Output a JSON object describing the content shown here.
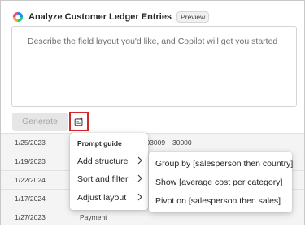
{
  "header": {
    "title": "Analyze Customer Ledger Entries",
    "badge": "Preview"
  },
  "prompt": {
    "placeholder": "Describe the field layout you'd like, and Copilot will get you started"
  },
  "actions": {
    "generate_label": "Generate"
  },
  "grid": {
    "rows": [
      {
        "date": "1/25/2023",
        "doc": "5-INV103009",
        "amount": "30000"
      },
      {
        "date": "1/19/2023",
        "doc": "",
        "amount": ""
      },
      {
        "date": "1/22/2024",
        "doc": "",
        "amount": ""
      },
      {
        "date": "1/17/2024",
        "doc": "",
        "amount": ""
      },
      {
        "date": "1/27/2023",
        "doc": "Payment",
        "amount": ""
      }
    ]
  },
  "prompt_guide": {
    "header": "Prompt guide",
    "items": [
      {
        "label": "Add structure"
      },
      {
        "label": "Sort and filter"
      },
      {
        "label": "Adjust layout"
      }
    ]
  },
  "submenu": {
    "items": [
      {
        "label": "Group by [salesperson then country]"
      },
      {
        "label": "Show [average cost per category]"
      },
      {
        "label": "Pivot on [salesperson then sales]"
      }
    ]
  },
  "icons": {
    "copilot_logo": "copilot-logo-icon",
    "prompt_guide": "prompt-guide-icon",
    "chevron": "chevron-right-icon"
  },
  "colors": {
    "highlight_border": "#d62828",
    "generate_disabled_bg": "#e6e6e6",
    "generate_disabled_text": "#a8a8a8"
  }
}
